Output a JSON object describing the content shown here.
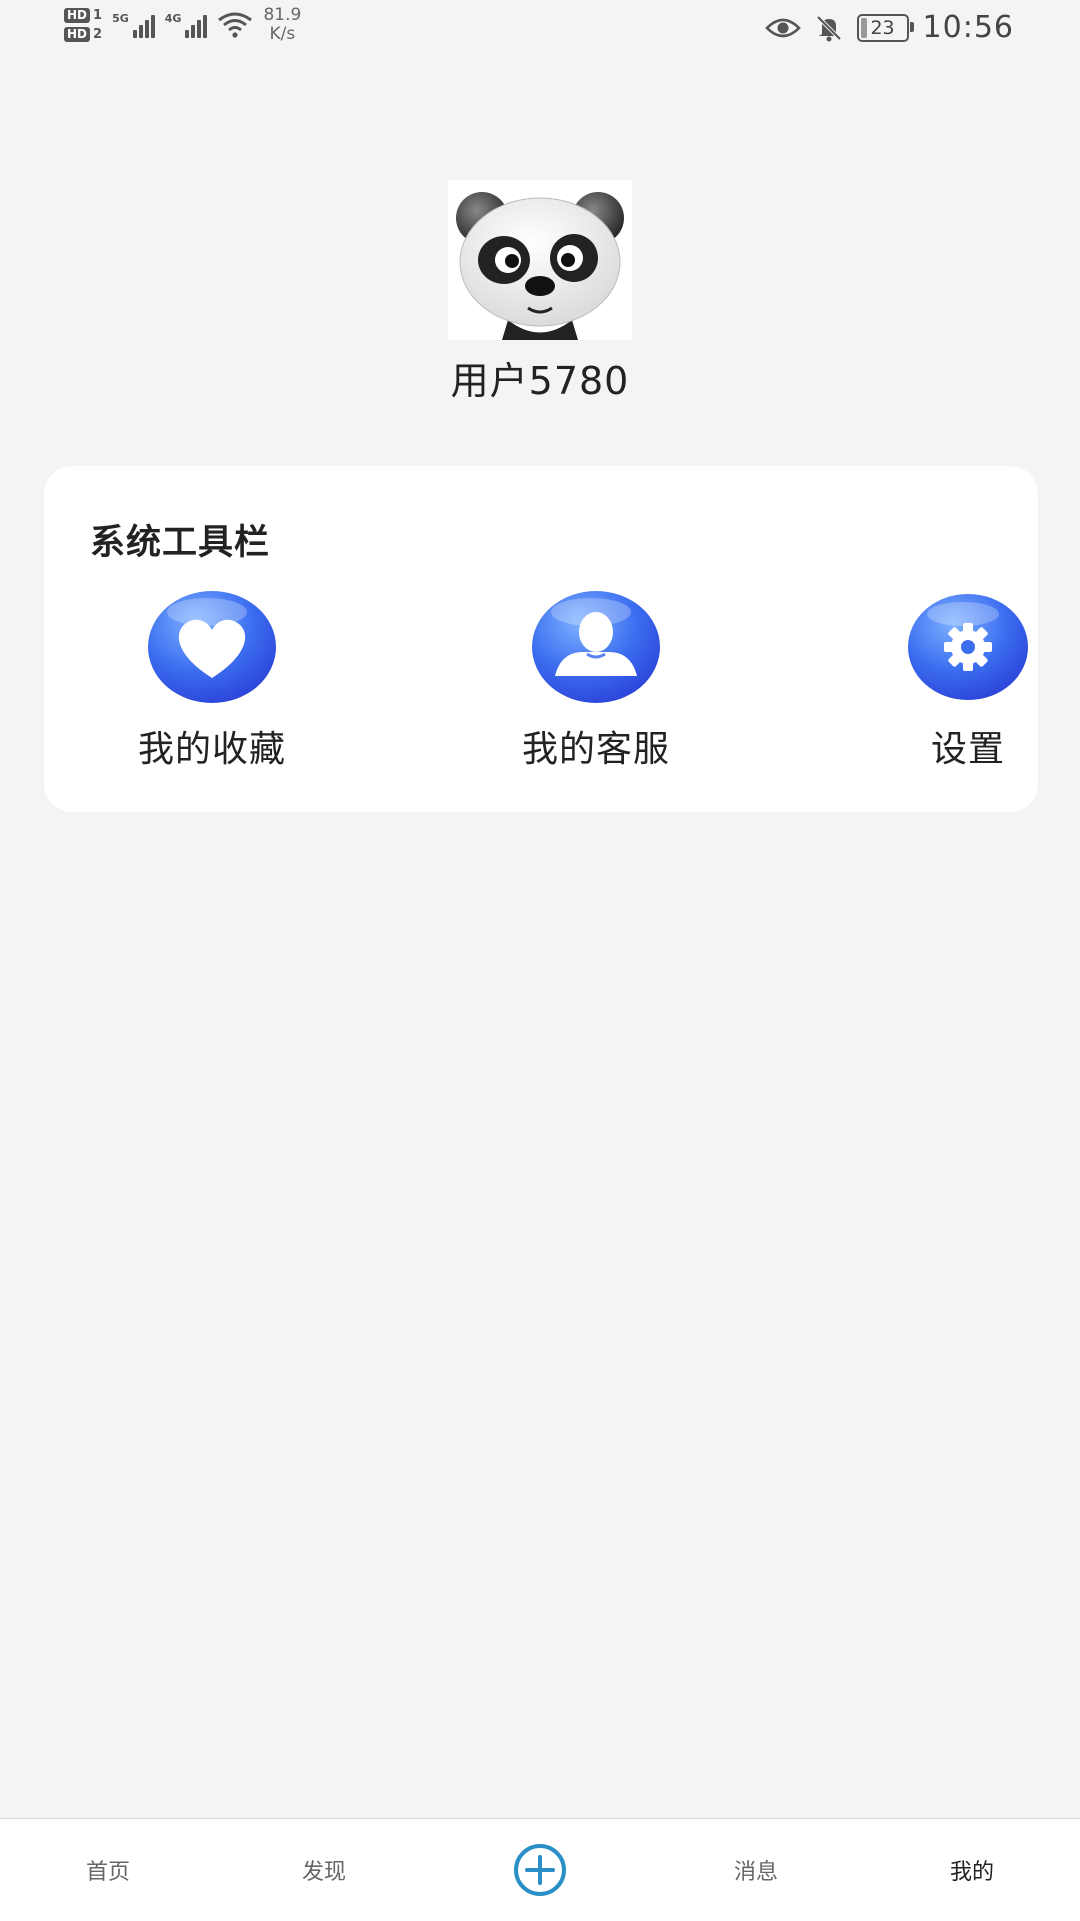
{
  "status_bar": {
    "sim1": "HD",
    "sim1_num": "1",
    "sim2": "HD",
    "sim2_num": "2",
    "net1": "5G",
    "net2": "4G",
    "speed_value": "81.9",
    "speed_unit": "K/s",
    "battery": "23",
    "time": "10:56",
    "icons": [
      "eye-icon",
      "mute-bell-icon",
      "battery-icon",
      "wifi-icon",
      "signal-icon"
    ]
  },
  "profile": {
    "username": "用户5780",
    "avatar_icon": "panda-avatar"
  },
  "tools_card": {
    "title": "系统工具栏",
    "items": [
      {
        "label": "我的收藏",
        "icon": "heart-icon"
      },
      {
        "label": "我的客服",
        "icon": "user-icon"
      },
      {
        "label": "设置",
        "icon": "gear-icon"
      }
    ]
  },
  "bottom_nav": {
    "items": [
      {
        "label": "首页"
      },
      {
        "label": "发现"
      },
      {
        "label": "",
        "icon": "plus-circle-icon"
      },
      {
        "label": "消息"
      },
      {
        "label": "我的"
      }
    ],
    "active": "我的"
  },
  "colors": {
    "background": "#f4f4f6",
    "icon_blue": "#3f63f0",
    "accent_plus": "#2a8fc7"
  }
}
